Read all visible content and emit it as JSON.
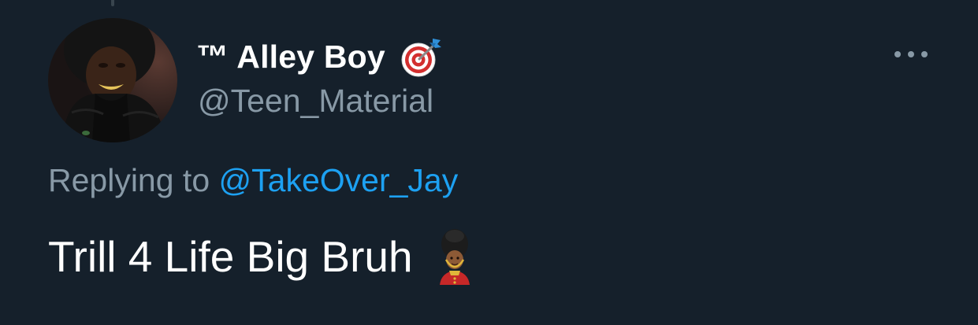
{
  "tweet": {
    "author": {
      "display_name": "™ Alley Boy",
      "badge_emoji": "direct-hit-icon",
      "handle": "@Teen_Material"
    },
    "reply": {
      "prefix": "Replying to",
      "to_handle": "@TakeOver_Jay"
    },
    "text": "Trill 4 Life Big Bruh",
    "trailing_emoji": "guardsman-icon"
  },
  "theme": {
    "background": "#15202b",
    "primary_text": "#ffffff",
    "secondary_text": "#8899a6",
    "link": "#1da1f2"
  }
}
